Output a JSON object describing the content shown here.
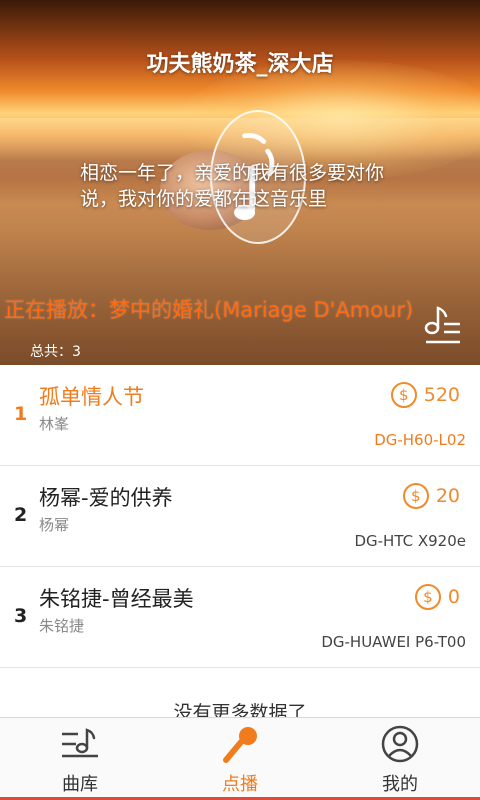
{
  "header": {
    "store_name": "功夫熊奶茶_深大店",
    "message": "相恋一年了，亲爱的我有很多要对你说，我对你的爱都在这音乐里",
    "now_playing": "正在播放：梦中的婚礼(Mariage D'Amour)",
    "total_label": "总共：",
    "total_count": "3"
  },
  "songs": [
    {
      "index": "1",
      "title": "孤单情人节",
      "artist": "林峯",
      "price": "520",
      "device": "DG-H60-L02"
    },
    {
      "index": "2",
      "title": "杨幂-爱的供养",
      "artist": "杨幂",
      "price": "20",
      "device": "DG-HTC X920e"
    },
    {
      "index": "3",
      "title": "朱铭捷-曾经最美",
      "artist": "朱铭捷",
      "price": "0",
      "device": "DG-HUAWEI P6-T00"
    }
  ],
  "footer_text": "没有更多数据了",
  "tabs": [
    {
      "label": "曲库",
      "icon": "music-library-icon"
    },
    {
      "label": "点播",
      "icon": "microphone-icon"
    },
    {
      "label": "我的",
      "icon": "profile-icon"
    }
  ],
  "colors": {
    "accent": "#f07c1e",
    "coin": "#f08a2c",
    "now_playing": "#ff6a12"
  }
}
